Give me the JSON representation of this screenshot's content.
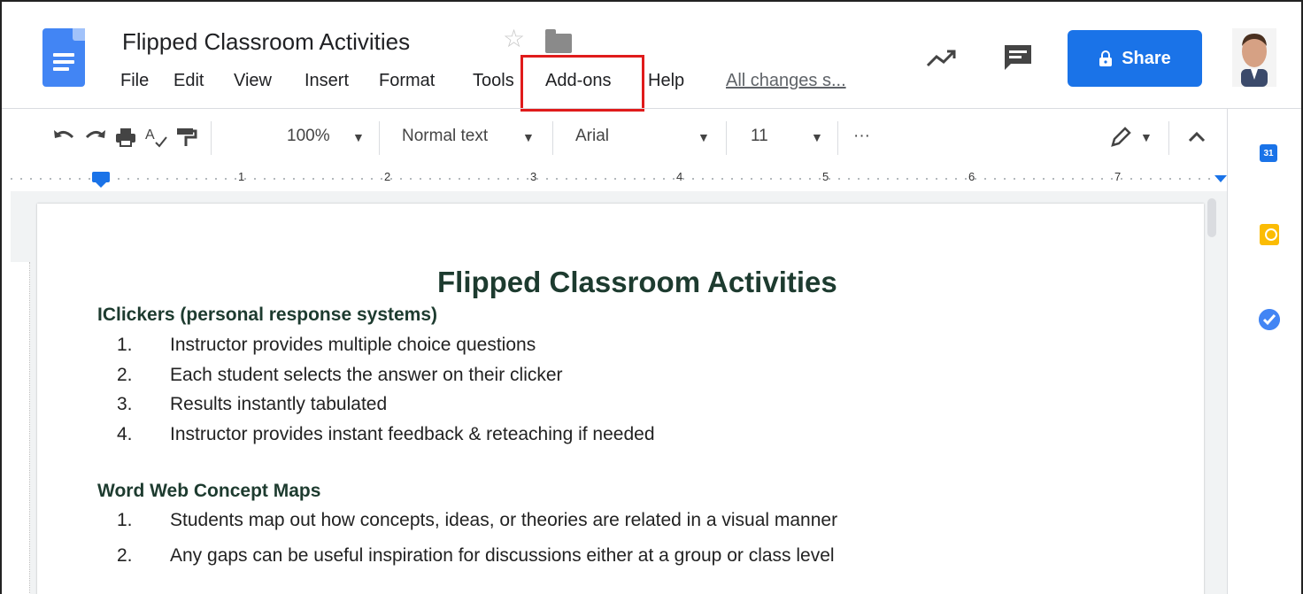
{
  "header": {
    "doc_title": "Flipped Classroom Activities",
    "save_status": "All changes s...",
    "share_label": "Share"
  },
  "menu": [
    "File",
    "Edit",
    "View",
    "Insert",
    "Format",
    "Tools",
    "Add-ons",
    "Help"
  ],
  "toolbar": {
    "zoom": "100%",
    "style": "Normal text",
    "font": "Arial",
    "font_size": "11",
    "more": "···"
  },
  "ruler": {
    "numbers": [
      "1",
      "2",
      "3",
      "4",
      "5",
      "6",
      "7"
    ]
  },
  "document": {
    "title": "Flipped Classroom Activities",
    "sections": [
      {
        "heading": "IClickers (personal response systems)",
        "items": [
          {
            "num": "1.",
            "text": "Instructor provides multiple choice questions"
          },
          {
            "num": "2.",
            "text": "Each student selects the answer on their clicker"
          },
          {
            "num": "3.",
            "text": "Results instantly tabulated"
          },
          {
            "num": "4.",
            "text": "Instructor provides instant feedback & reteaching if needed"
          }
        ]
      },
      {
        "heading": "Word Web Concept Maps",
        "items": [
          {
            "num": "1.",
            "text": "Students map out how concepts, ideas, or theories are related in a visual manner"
          },
          {
            "num": "2.",
            "text": "Any gaps can be useful inspiration for discussions either at a group or class level"
          }
        ]
      }
    ]
  },
  "side_panel": {
    "calendar_day": "31"
  },
  "colors": {
    "accent": "#1a73e8",
    "highlight": "#e01b1b",
    "doc_text": "#1d3b2f"
  },
  "icons": [
    "docs-logo-icon",
    "star-icon",
    "folder-icon",
    "activity-trend-icon",
    "comment-icon",
    "lock-icon",
    "undo-icon",
    "redo-icon",
    "print-icon",
    "spellcheck-icon",
    "paint-format-icon",
    "pencil-icon",
    "collapse-icon",
    "calendar-icon",
    "keep-icon",
    "tasks-icon"
  ]
}
